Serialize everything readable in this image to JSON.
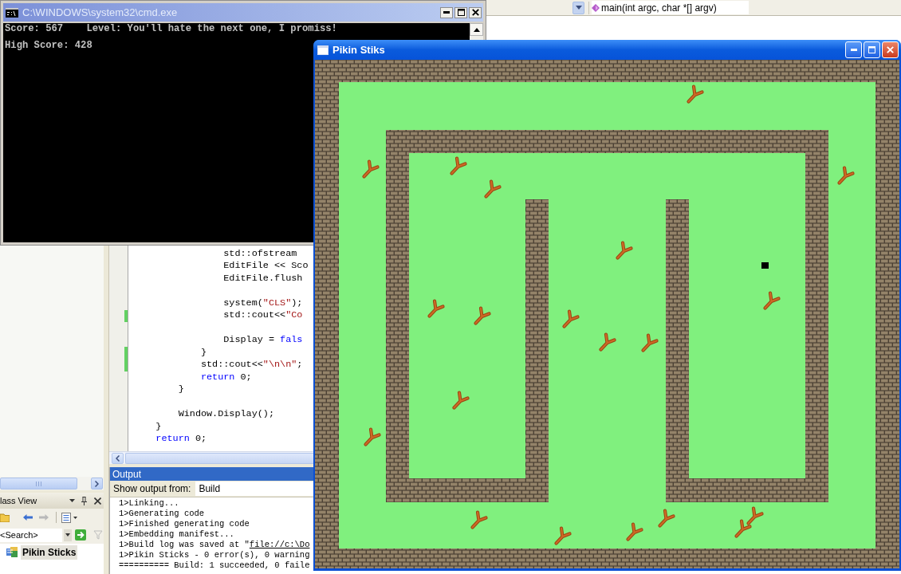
{
  "ide_toolbar": {
    "member_dropdown": "main(int argc, char *[] argv)"
  },
  "console_window": {
    "title": "C:\\WINDOWS\\system32\\cmd.exe",
    "active": false,
    "lines": [
      "Score: 567    Level: You'll hate the next one, I promiss!",
      "High Score: 428"
    ]
  },
  "code_editor": {
    "blocks": [
      {
        "lines": [
          {
            "changed": false,
            "segments": [
              {
                "kind": "plain",
                "text": "                std::ofstream"
              }
            ]
          },
          {
            "changed": false,
            "segments": [
              {
                "kind": "plain",
                "text": "                EditFile << Sco"
              }
            ]
          },
          {
            "changed": false,
            "segments": [
              {
                "kind": "plain",
                "text": "                EditFile.flush"
              }
            ]
          }
        ]
      },
      {
        "lines": [
          {
            "changed": false,
            "segments": [
              {
                "kind": "plain",
                "text": "                system("
              },
              {
                "kind": "string",
                "text": "\"CLS\""
              },
              {
                "kind": "plain",
                "text": ");"
              }
            ]
          },
          {
            "changed": true,
            "segments": [
              {
                "kind": "plain",
                "text": "                std::cout<<"
              },
              {
                "kind": "string",
                "text": "\"Co"
              }
            ]
          }
        ]
      },
      {
        "lines": [
          {
            "changed": false,
            "segments": [
              {
                "kind": "plain",
                "text": "                Display = "
              },
              {
                "kind": "keyword",
                "text": "fals"
              }
            ]
          },
          {
            "changed": true,
            "segments": [
              {
                "kind": "plain",
                "text": "            }"
              }
            ]
          },
          {
            "changed": true,
            "segments": [
              {
                "kind": "plain",
                "text": "            std::cout<<"
              },
              {
                "kind": "string",
                "text": "\"\\n\\n\""
              },
              {
                "kind": "plain",
                "text": ";"
              }
            ]
          },
          {
            "changed": false,
            "segments": [
              {
                "kind": "keyword",
                "text": "            return"
              },
              {
                "kind": "plain",
                "text": " 0;"
              }
            ]
          },
          {
            "changed": false,
            "segments": [
              {
                "kind": "plain",
                "text": "        }"
              }
            ]
          }
        ]
      },
      {
        "lines": [
          {
            "changed": false,
            "segments": [
              {
                "kind": "plain",
                "text": "        Window.Display();"
              }
            ]
          },
          {
            "changed": false,
            "segments": [
              {
                "kind": "plain",
                "text": "    }"
              }
            ]
          },
          {
            "changed": false,
            "segments": [
              {
                "kind": "keyword",
                "text": "    return"
              },
              {
                "kind": "plain",
                "text": " 0;"
              }
            ]
          }
        ]
      }
    ]
  },
  "class_view": {
    "title": "lass View",
    "search": {
      "placeholder": "<Search>"
    },
    "tree": [
      {
        "label": "Pikin Sticks",
        "selected": true
      }
    ]
  },
  "output_panel": {
    "title": "Output",
    "show_output_from": "Show output from:",
    "source": "Build",
    "lines": [
      {
        "segments": [
          {
            "kind": "plain",
            "text": "1>Linking..."
          }
        ]
      },
      {
        "segments": [
          {
            "kind": "plain",
            "text": "1>Generating code"
          }
        ]
      },
      {
        "segments": [
          {
            "kind": "plain",
            "text": "1>Finished generating code"
          }
        ]
      },
      {
        "segments": [
          {
            "kind": "plain",
            "text": "1>Embedding manifest..."
          }
        ]
      },
      {
        "segments": [
          {
            "kind": "plain",
            "text": "1>Build log was saved at \""
          },
          {
            "kind": "link",
            "text": "file://c:\\Do"
          }
        ]
      },
      {
        "segments": [
          {
            "kind": "plain",
            "text": "1>Pikin Sticks - 0 error(s), 0 warning"
          }
        ]
      },
      {
        "segments": [
          {
            "kind": "plain",
            "text": "========== Build: 1 succeeded, 0 faile"
          }
        ]
      }
    ]
  },
  "game_window": {
    "title": "Pikin Stiks",
    "active": true
  }
}
